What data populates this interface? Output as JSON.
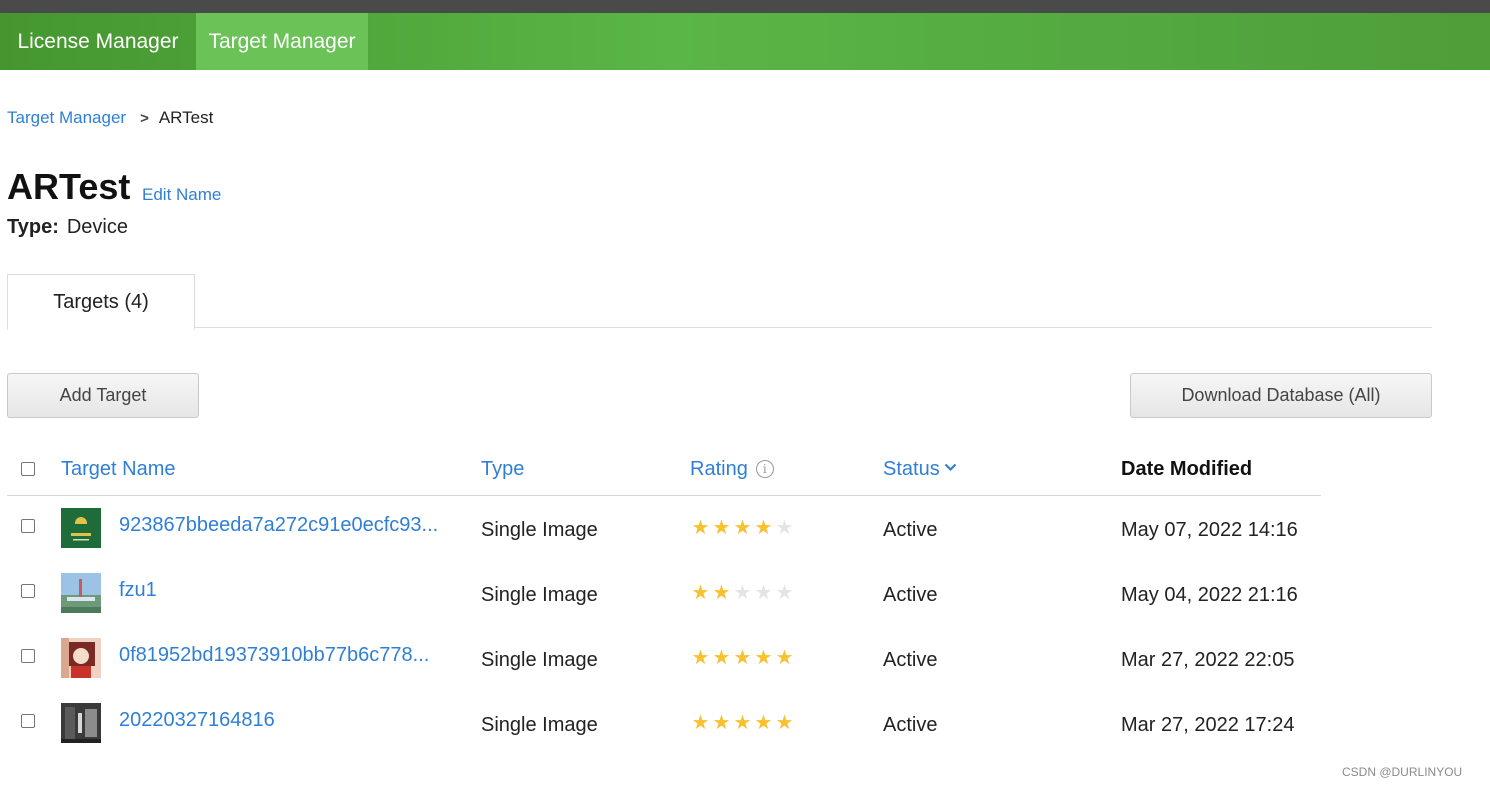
{
  "nav": {
    "tabs": [
      {
        "label": "License Manager"
      },
      {
        "label": "Target Manager"
      }
    ]
  },
  "breadcrumb": {
    "root": "Target Manager",
    "current": "ARTest"
  },
  "database": {
    "name": "ARTest",
    "edit_label": "Edit Name",
    "type_label": "Type:",
    "type_value": "Device"
  },
  "tabs": {
    "targets": "Targets (4)"
  },
  "buttons": {
    "add": "Add Target",
    "download": "Download Database (All)"
  },
  "table": {
    "headers": {
      "name": "Target Name",
      "type": "Type",
      "rating": "Rating",
      "status": "Status",
      "date": "Date Modified"
    },
    "rows": [
      {
        "name": "923867bbeeda7a272c91e0ecfc93...",
        "type": "Single Image",
        "rating": 4,
        "status": "Active",
        "date": "May 07, 2022 14:16"
      },
      {
        "name": "fzu1",
        "type": "Single Image",
        "rating": 2,
        "status": "Active",
        "date": "May 04, 2022 21:16"
      },
      {
        "name": "0f81952bd19373910bb77b6c778...",
        "type": "Single Image",
        "rating": 5,
        "status": "Active",
        "date": "Mar 27, 2022 22:05"
      },
      {
        "name": "20220327164816",
        "type": "Single Image",
        "rating": 5,
        "status": "Active",
        "date": "Mar 27, 2022 17:24"
      }
    ]
  },
  "colors": {
    "nav_green": "#5ab646",
    "link_blue": "#2f7fd6",
    "star_gold": "#f7c12f"
  },
  "watermark": "CSDN @DURLINYOU"
}
